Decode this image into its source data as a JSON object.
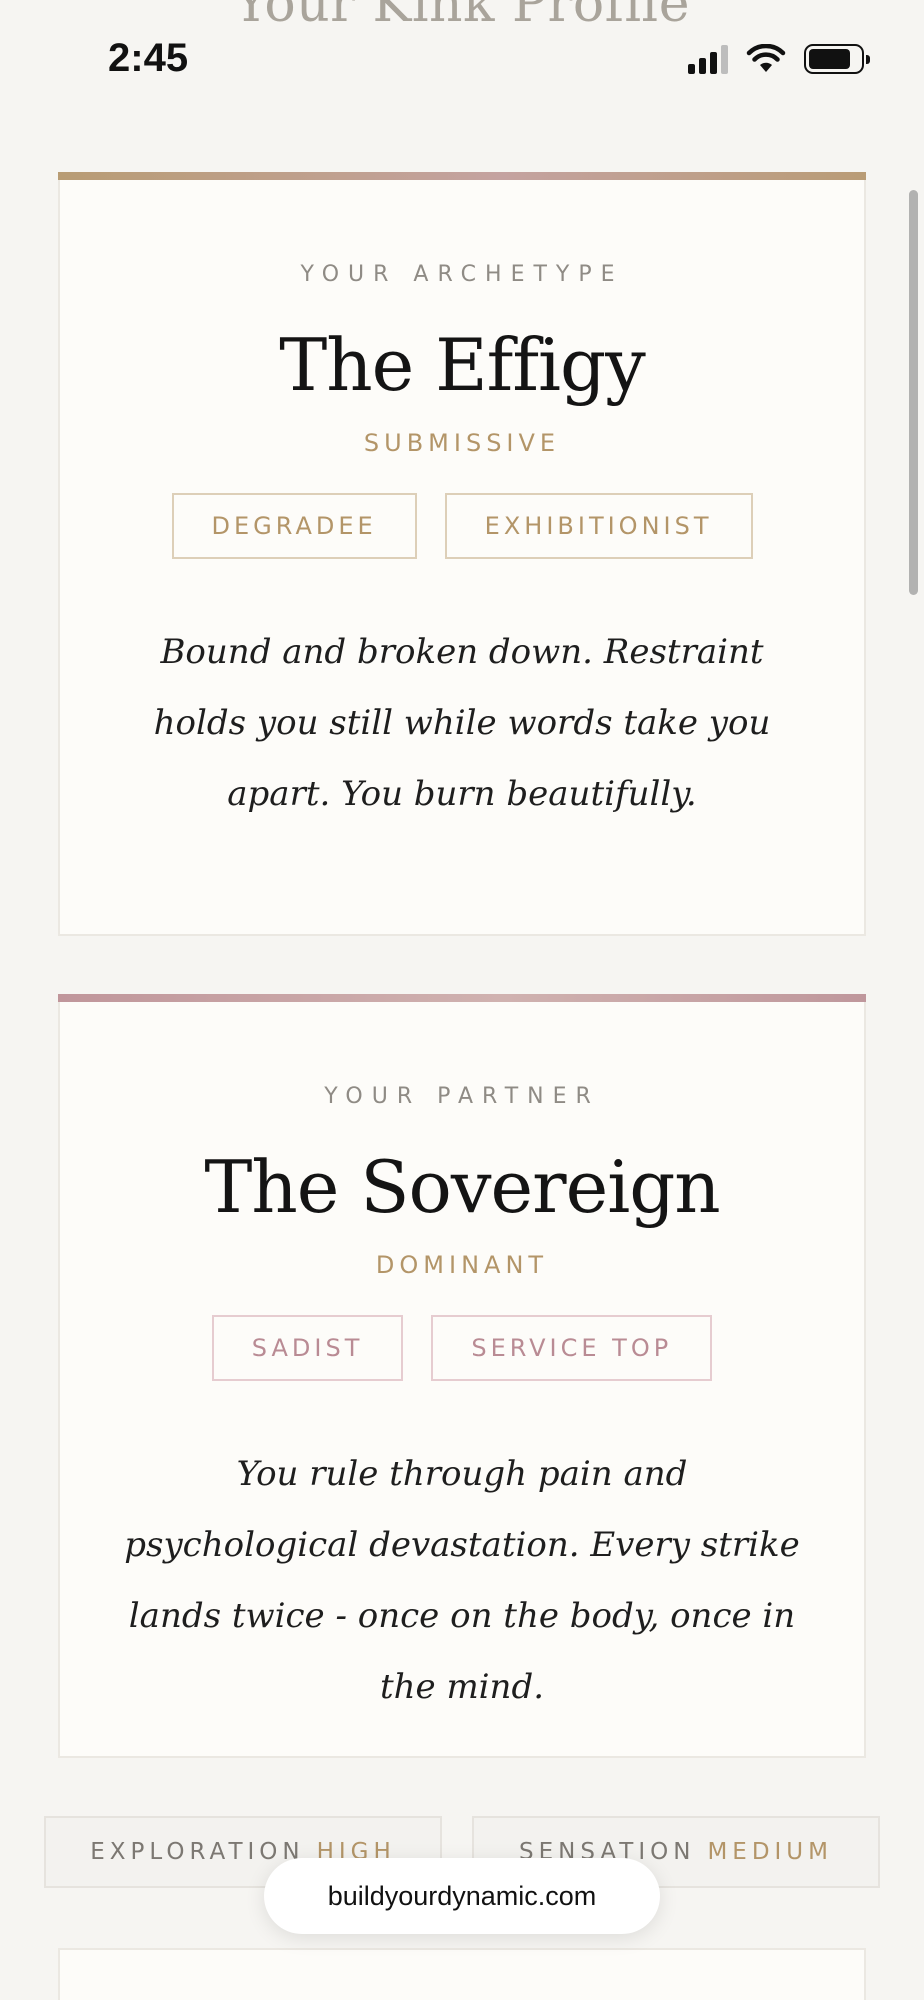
{
  "page": {
    "title_peek": "Your Kink Profile"
  },
  "status_bar": {
    "time": "2:45",
    "icons": [
      "cellular-signal-icon",
      "wifi-icon",
      "battery-icon"
    ]
  },
  "archetype_card": {
    "eyebrow": "YOUR ARCHETYPE",
    "name": "The Effigy",
    "role": "SUBMISSIVE",
    "tags": [
      "DEGRADEE",
      "EXHIBITIONIST"
    ],
    "description": "Bound and broken down. Restraint holds you still while words take you apart. You burn beautifully.",
    "accent_color": "#b39568"
  },
  "partner_card": {
    "eyebrow": "YOUR PARTNER",
    "name": "The Sovereign",
    "role": "DOMINANT",
    "tags": [
      "SADIST",
      "SERVICE TOP"
    ],
    "description": "You rule through pain and psychological devastation. Every strike lands twice - once on the body, once in the mind.",
    "accent_color": "#b98b94"
  },
  "stats": [
    {
      "label": "EXPLORATION",
      "value": "HIGH"
    },
    {
      "label": "SENSATION",
      "value": "MEDIUM"
    }
  ],
  "browser": {
    "url": "buildyourdynamic.com"
  }
}
